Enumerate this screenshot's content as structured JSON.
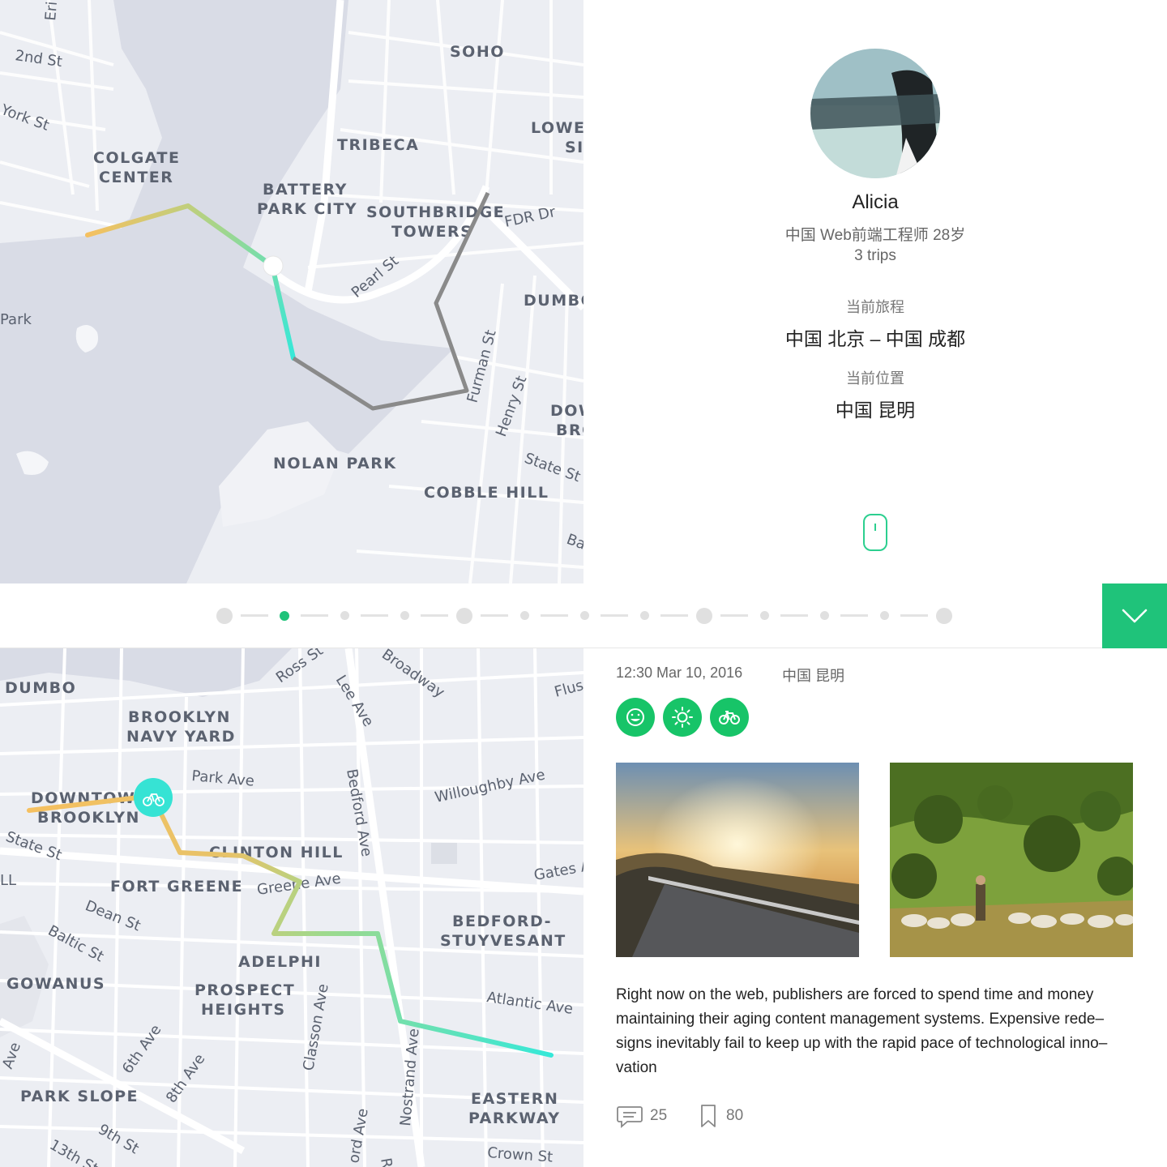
{
  "top_map": {
    "labels": [
      {
        "text": "SOHO"
      },
      {
        "text": "TRIBECA"
      },
      {
        "text": "COLGATE"
      },
      {
        "text": "CENTER"
      },
      {
        "text": "BATTERY"
      },
      {
        "text": "PARK CITY"
      },
      {
        "text": "SOUTHBRIDGE"
      },
      {
        "text": "TOWERS"
      },
      {
        "text": "LOWER"
      },
      {
        "text": "SI"
      },
      {
        "text": "DUMBO"
      },
      {
        "text": "DOW"
      },
      {
        "text": "BRO"
      },
      {
        "text": "NOLAN PARK"
      },
      {
        "text": "COBBLE HILL"
      }
    ],
    "streets": [
      "2nd St",
      "York St",
      "Park",
      "FDR Dr",
      "Pearl St",
      "Furman St",
      "Henry St",
      "State St",
      "Ba",
      "Eri"
    ]
  },
  "bottom_map": {
    "labels": [
      {
        "text": "DUMBO"
      },
      {
        "text": "BROOKLYN"
      },
      {
        "text": "NAVY YARD"
      },
      {
        "text": "DOWNTOWN"
      },
      {
        "text": "BROOKLYN"
      },
      {
        "text": "CLINTON HILL"
      },
      {
        "text": "FORT GREENE"
      },
      {
        "text": "BEDFORD-"
      },
      {
        "text": "STUYVESANT"
      },
      {
        "text": "ADELPHI"
      },
      {
        "text": "GOWANUS"
      },
      {
        "text": "PROSPECT"
      },
      {
        "text": "HEIGHTS"
      },
      {
        "text": "PARK SLOPE"
      },
      {
        "text": "EASTERN"
      },
      {
        "text": "PARKWAY"
      }
    ],
    "streets": [
      "Ross St",
      "Broadway",
      "Lee Ave",
      "Flus",
      "Park Ave",
      "Willoughby Ave",
      "Bedford Ave",
      "State St",
      "Greene Ave",
      "Gates A",
      "Dean St",
      "Baltic St",
      "Atlantic Ave",
      "Classon Ave",
      "6th Ave",
      "8th Ave",
      "Nostrand Ave",
      "9th St",
      "13th St",
      "Crown St",
      "Rog",
      "ord Ave",
      "LL",
      "Ave"
    ]
  },
  "profile": {
    "name": "Alicia",
    "bio": "中国 Web前端工程师 28岁",
    "trips": "3 trips",
    "current_trip_label": "当前旅程",
    "current_trip": "中国 北京 –  中国 成都",
    "current_location_label": "当前位置",
    "current_location": "中国 昆明"
  },
  "timeline": {
    "stops": 13,
    "active_index": 1
  },
  "detail": {
    "time": "12:30 Mar 10, 2016",
    "location": "中国 昆明",
    "tags": [
      "smile-icon",
      "sun-icon",
      "bicycle-icon"
    ],
    "photos": [
      "sunset-road-photo",
      "shepherd-sheep-photo"
    ],
    "text_lines": [
      "Right now on the web, publishers are forced to spend time and money",
      "maintaining their aging content management systems. Expensive rede–",
      "signs inevitably fail to keep up with the rapid pace of technological inno–",
      "vation"
    ],
    "comments": "25",
    "bookmarks": "80"
  },
  "colors": {
    "accent": "#1fc37a",
    "tag_green": "#17c468",
    "route_yellow": "#f5c060",
    "route_cyan": "#36e8d8",
    "route_gray": "#8a8a8a",
    "map_bg": "#eceef3",
    "water": "#d8dbe5"
  }
}
